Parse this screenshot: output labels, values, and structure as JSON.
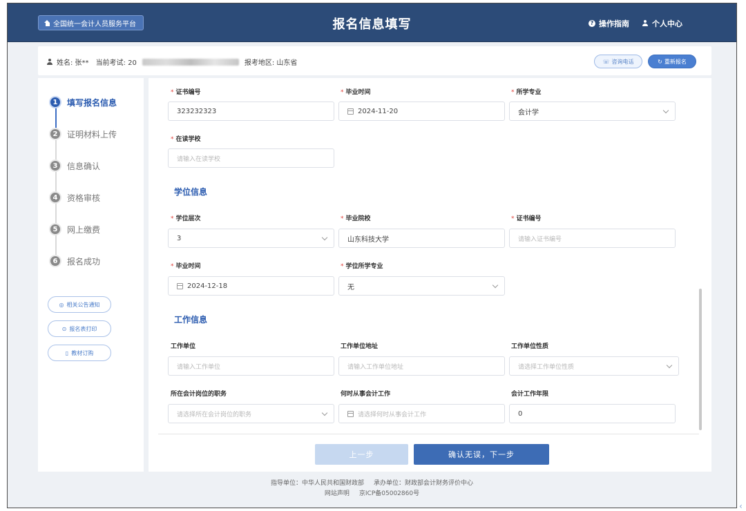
{
  "header": {
    "brand_label": "全国统一会计人员服务平台",
    "title": "报名信息填写",
    "guide_label": "操作指南",
    "user_center_label": "个人中心"
  },
  "infobar": {
    "name": "姓名: 张**",
    "exam": "当前考试: 20",
    "region": "报考地区: 山东省",
    "consult_phone_label": "咨询电话",
    "re_register_label": "重新报名"
  },
  "sidebar": {
    "steps": [
      {
        "num": "1",
        "label": "填写报名信息"
      },
      {
        "num": "2",
        "label": "证明材料上传"
      },
      {
        "num": "3",
        "label": "信息确认"
      },
      {
        "num": "4",
        "label": "资格审核"
      },
      {
        "num": "5",
        "label": "网上缴费"
      },
      {
        "num": "6",
        "label": "报名成功"
      }
    ],
    "links": [
      {
        "label": "相关公告通知"
      },
      {
        "label": "报名表打印"
      },
      {
        "label": "教材订购"
      }
    ]
  },
  "education": {
    "cert_no_label": "证书编号",
    "cert_no_value": "323232323",
    "grad_time_label": "毕业时间",
    "grad_time_value": "2024-11-20",
    "major_label": "所学专业",
    "major_value": "会计学",
    "school_label": "在读学校",
    "school_placeholder": "请输入在读学校"
  },
  "degree": {
    "section_title": "学位信息",
    "level_label": "学位层次",
    "level_value": "3",
    "grad_school_label": "毕业院校",
    "grad_school_value": "山东科技大学",
    "cert_no_label": "证书编号",
    "cert_no_placeholder": "请输入证书编号",
    "grad_time_label": "毕业时间",
    "grad_time_value": "2024-12-18",
    "major_label": "学位所学专业",
    "major_value": "无"
  },
  "work": {
    "section_title": "工作信息",
    "unit_label": "工作单位",
    "unit_placeholder": "请输入工作单位",
    "address_label": "工作单位地址",
    "address_placeholder": "请输入工作单位地址",
    "nature_label": "工作单位性质",
    "nature_placeholder": "请选择工作单位性质",
    "position_label": "所在会计岗位的职务",
    "position_placeholder": "请选择所在会计岗位的职务",
    "start_label": "何时从事会计工作",
    "start_placeholder": "请选择何时从事会计工作",
    "years_label": "会计工作年限",
    "years_value": "0"
  },
  "actions": {
    "prev_label": "上一步",
    "next_label": "确认无误，下一步"
  },
  "footer": {
    "guide_unit": "指导单位：中华人民共和国财政部",
    "host_unit": "承办单位：财政部会计财务评价中心",
    "statement": "网站声明",
    "icp": "京ICP备05002860号"
  }
}
